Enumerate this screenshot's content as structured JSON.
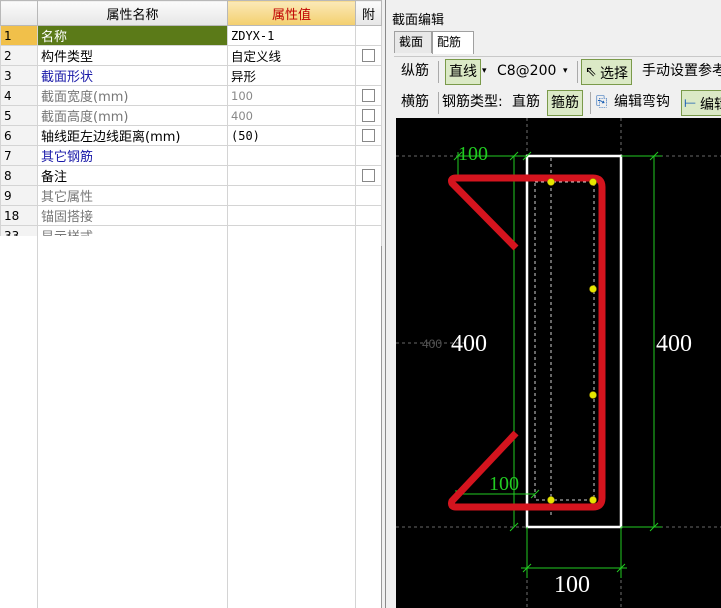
{
  "grid": {
    "headers": {
      "name": "属性名称",
      "value": "属性值",
      "attach": "附"
    },
    "rows": [
      {
        "num": "1",
        "name": "名称",
        "value": "ZDYX-1",
        "check": false,
        "style": "sel"
      },
      {
        "num": "2",
        "name": "构件类型",
        "value": "自定义线",
        "check": true,
        "style": ""
      },
      {
        "num": "3",
        "name": "截面形状",
        "value": "异形",
        "check": false,
        "style": "blue"
      },
      {
        "num": "4",
        "name": "截面宽度(mm)",
        "value": "100",
        "check": true,
        "style": "grey"
      },
      {
        "num": "5",
        "name": "截面高度(mm)",
        "value": "400",
        "check": true,
        "style": "grey"
      },
      {
        "num": "6",
        "name": "轴线距左边线距离(mm)",
        "value": "(50)",
        "check": true,
        "style": ""
      },
      {
        "num": "7",
        "name": "其它钢筋",
        "value": "",
        "check": false,
        "style": "blue"
      },
      {
        "num": "8",
        "name": "备注",
        "value": "",
        "check": true,
        "style": ""
      },
      {
        "num": "9",
        "name": "其它属性",
        "value": "",
        "check": false,
        "style": "grey",
        "expand": true
      },
      {
        "num": "18",
        "name": "锚固搭接",
        "value": "",
        "check": false,
        "style": "grey",
        "expand": true
      },
      {
        "num": "33",
        "name": "显示样式",
        "value": "",
        "check": false,
        "style": "grey",
        "expand": true
      }
    ]
  },
  "editor": {
    "title": "截面编辑",
    "tabs": [
      "截面",
      "配筋"
    ],
    "toolbar1": {
      "longitudinal": "纵筋",
      "line_btn": "直线",
      "spec": "C8@200",
      "select_btn": "选择",
      "manual": "手动设置参考"
    },
    "toolbar2": {
      "horizontal": "横筋",
      "type_label": "钢筋类型:",
      "type_value": "直筋",
      "stirrup_btn": "箍筋",
      "edit_hook": "编辑弯钩",
      "edit2": "编辑"
    },
    "drawing": {
      "dim_top": "100",
      "dim_left": "400",
      "dim_right": "400",
      "dim_bottom_inner": "100",
      "dim_bottom": "100",
      "ghost_label": "400"
    }
  },
  "colors": {
    "rebar": "#d4141e",
    "dim": "#22cc22",
    "outline": "#ffffff",
    "point": "#e6e600"
  }
}
